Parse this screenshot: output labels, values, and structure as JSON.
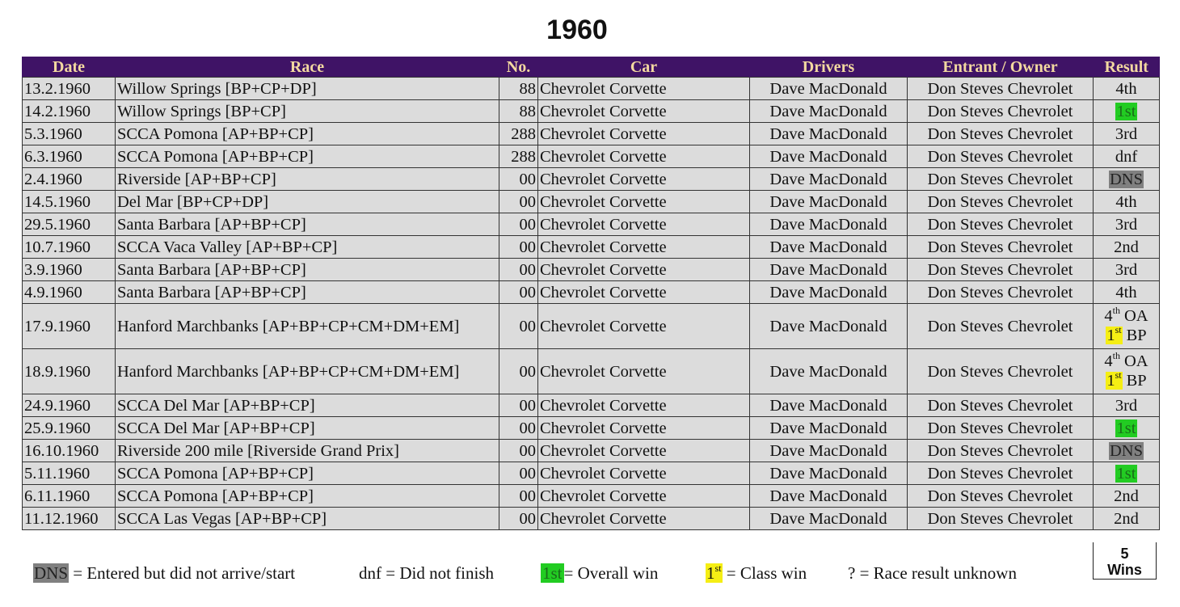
{
  "title": "1960",
  "table": {
    "headers": [
      "Date",
      "Race",
      "No.",
      "Car",
      "Drivers",
      "Entrant / Owner",
      "Result"
    ],
    "rows": [
      {
        "date": "13.2.1960",
        "race": "Willow Springs [BP+CP+DP]",
        "no": "88",
        "car": "Chevrolet Corvette",
        "driver": "Dave MacDonald",
        "entrant": "Don Steves Chevrolet",
        "result": "4th",
        "result_style": "plain"
      },
      {
        "date": "14.2.1960",
        "race": "Willow Springs [BP+CP]",
        "no": "88",
        "car": "Chevrolet Corvette",
        "driver": "Dave MacDonald",
        "entrant": "Don Steves Chevrolet",
        "result": "1st",
        "result_style": "overall-win"
      },
      {
        "date": "5.3.1960",
        "race": "SCCA Pomona [AP+BP+CP]",
        "no": "288",
        "car": "Chevrolet Corvette",
        "driver": "Dave MacDonald",
        "entrant": "Don Steves Chevrolet",
        "result": "3rd",
        "result_style": "plain"
      },
      {
        "date": "6.3.1960",
        "race": "SCCA Pomona [AP+BP+CP]",
        "no": "288",
        "car": "Chevrolet Corvette",
        "driver": "Dave MacDonald",
        "entrant": "Don Steves Chevrolet",
        "result": "dnf",
        "result_style": "plain"
      },
      {
        "date": "2.4.1960",
        "race": "Riverside [AP+BP+CP]",
        "no": "00",
        "car": "Chevrolet Corvette",
        "driver": "Dave MacDonald",
        "entrant": "Don Steves Chevrolet",
        "result": "DNS",
        "result_style": "dns"
      },
      {
        "date": "14.5.1960",
        "race": "Del Mar [BP+CP+DP]",
        "no": "00",
        "car": "Chevrolet Corvette",
        "driver": "Dave MacDonald",
        "entrant": "Don Steves Chevrolet",
        "result": "4th",
        "result_style": "plain"
      },
      {
        "date": "29.5.1960",
        "race": "Santa Barbara [AP+BP+CP]",
        "no": "00",
        "car": "Chevrolet Corvette",
        "driver": "Dave MacDonald",
        "entrant": "Don Steves Chevrolet",
        "result": "3rd",
        "result_style": "plain"
      },
      {
        "date": "10.7.1960",
        "race": "SCCA Vaca Valley [AP+BP+CP]",
        "no": "00",
        "car": "Chevrolet Corvette",
        "driver": "Dave MacDonald",
        "entrant": "Don Steves Chevrolet",
        "result": "2nd",
        "result_style": "plain"
      },
      {
        "date": "3.9.1960",
        "race": "Santa Barbara [AP+BP+CP]",
        "no": "00",
        "car": "Chevrolet Corvette",
        "driver": "Dave MacDonald",
        "entrant": "Don Steves Chevrolet",
        "result": "3rd",
        "result_style": "plain"
      },
      {
        "date": "4.9.1960",
        "race": "Santa Barbara [AP+BP+CP]",
        "no": "00",
        "car": "Chevrolet Corvette",
        "driver": "Dave MacDonald",
        "entrant": "Don Steves Chevrolet",
        "result": "4th",
        "result_style": "plain"
      },
      {
        "date": "17.9.1960",
        "race": "Hanford Marchbanks [AP+BP+CP+CM+DM+EM]",
        "no": "00",
        "car": "Chevrolet Corvette",
        "driver": "Dave MacDonald",
        "entrant": "Don Steves Chevrolet",
        "result_style": "multi",
        "result_lines": [
          {
            "num": "4",
            "sup": "th",
            "suffix": "OA",
            "style": "plain"
          },
          {
            "num": "1",
            "sup": "st",
            "suffix": "BP",
            "style": "class-win"
          }
        ]
      },
      {
        "date": "18.9.1960",
        "race": "Hanford Marchbanks [AP+BP+CP+CM+DM+EM]",
        "no": "00",
        "car": "Chevrolet Corvette",
        "driver": "Dave MacDonald",
        "entrant": "Don Steves Chevrolet",
        "result_style": "multi",
        "result_lines": [
          {
            "num": "4",
            "sup": "th",
            "suffix": "OA",
            "style": "plain"
          },
          {
            "num": "1",
            "sup": "st",
            "suffix": "BP",
            "style": "class-win"
          }
        ]
      },
      {
        "date": "24.9.1960",
        "race": "SCCA Del Mar [AP+BP+CP]",
        "no": "00",
        "car": "Chevrolet Corvette",
        "driver": "Dave MacDonald",
        "entrant": "Don Steves Chevrolet",
        "result": "3rd",
        "result_style": "plain"
      },
      {
        "date": "25.9.1960",
        "race": "SCCA Del Mar [AP+BP+CP]",
        "no": "00",
        "car": "Chevrolet Corvette",
        "driver": "Dave MacDonald",
        "entrant": "Don Steves Chevrolet",
        "result": "1st",
        "result_style": "overall-win"
      },
      {
        "date": "16.10.1960",
        "race": "Riverside 200 mile [Riverside Grand Prix]",
        "no": "00",
        "car": "Chevrolet Corvette",
        "driver": "Dave MacDonald",
        "entrant": "Don Steves Chevrolet",
        "result": "DNS",
        "result_style": "dns"
      },
      {
        "date": "5.11.1960",
        "race": "SCCA Pomona [AP+BP+CP]",
        "no": "00",
        "car": "Chevrolet Corvette",
        "driver": "Dave MacDonald",
        "entrant": "Don Steves Chevrolet",
        "result": "1st",
        "result_style": "overall-win"
      },
      {
        "date": "6.11.1960",
        "race": "SCCA Pomona [AP+BP+CP]",
        "no": "00",
        "car": "Chevrolet Corvette",
        "driver": "Dave MacDonald",
        "entrant": "Don Steves Chevrolet",
        "result": "2nd",
        "result_style": "plain"
      },
      {
        "date": "11.12.1960",
        "race": "SCCA Las Vegas [AP+BP+CP]",
        "no": "00",
        "car": "Chevrolet Corvette",
        "driver": "Dave MacDonald",
        "entrant": "Don Steves Chevrolet",
        "result": "2nd",
        "result_style": "plain"
      }
    ]
  },
  "wins": {
    "count": "5",
    "label": "Wins"
  },
  "legend": {
    "dns": {
      "key": "DNS",
      "text": "= Entered but did not arrive/start"
    },
    "dnf": {
      "key": "dnf",
      "text": "= Did not finish"
    },
    "overall": {
      "key": "1st",
      "text": "= Overall win"
    },
    "class": {
      "key_num": "1",
      "key_sup": "st",
      "text": "= Class win"
    },
    "unknown": {
      "key": "?",
      "text": "= Race result unknown"
    }
  },
  "colors": {
    "header_bg": "#3f1366",
    "header_text": "#f3d9a0",
    "cell_bg": "#dcdcdc",
    "overall_win": "#22cc22",
    "class_win": "#f5ee14",
    "dns": "#808080"
  }
}
